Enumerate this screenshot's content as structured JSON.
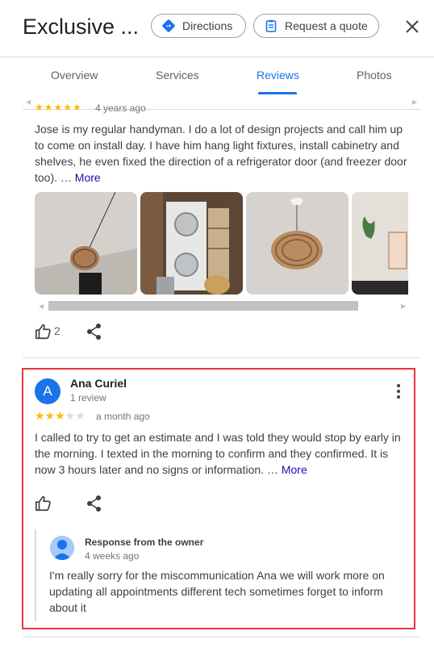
{
  "header": {
    "title": "Exclusive ...",
    "directions_label": "Directions",
    "quote_label": "Request a quote"
  },
  "tabs": [
    {
      "label": "Overview"
    },
    {
      "label": "Services"
    },
    {
      "label": "Reviews"
    },
    {
      "label": "Photos"
    }
  ],
  "review1": {
    "rating": 5,
    "time": "4 years ago",
    "text": "Jose is my regular handyman. I do a lot of design projects and call him up to come on install day. I have him hang light fixtures, install cabinetry and shelves, he even fixed the direction of a refrigerator door (and freezer door too). …",
    "more_label": "More",
    "likes": "2"
  },
  "review2": {
    "avatar_letter": "A",
    "name": "Ana Curiel",
    "count": "1 review",
    "rating": 3,
    "time": "a month ago",
    "text": "I called to try to get an estimate and I was told they would stop by early in the morning. I texted in the morning to confirm and they confirmed. It is now 3 hours later and no signs or information. …",
    "more_label": "More"
  },
  "owner_response": {
    "title": "Response from the owner",
    "time": "4 weeks ago",
    "text": "I'm really sorry for the miscommunication Ana we will work more on updating all appointments different tech sometimes forget to inform about it"
  },
  "colors": {
    "accent": "#1a73e8",
    "star": "#fbbc04",
    "highlight": "#e8363d"
  }
}
